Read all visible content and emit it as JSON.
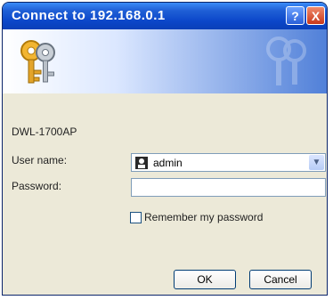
{
  "window": {
    "title": "Connect to 192.168.0.1",
    "help_label": "?",
    "close_label": "X"
  },
  "device_name": "DWL-1700AP",
  "form": {
    "user_label": "User name:",
    "user_value": "admin",
    "password_label": "Password:",
    "password_value": "",
    "remember_label": "Remember my password",
    "remember_checked": false
  },
  "buttons": {
    "ok_label": "OK",
    "cancel_label": "Cancel"
  },
  "icons": [
    "keys-icon",
    "user-icon",
    "dropdown-arrow-icon"
  ],
  "colors": {
    "titlebar": "#0b46c9",
    "dialog_bg": "#ece9d8",
    "close_button": "#c8381b"
  }
}
